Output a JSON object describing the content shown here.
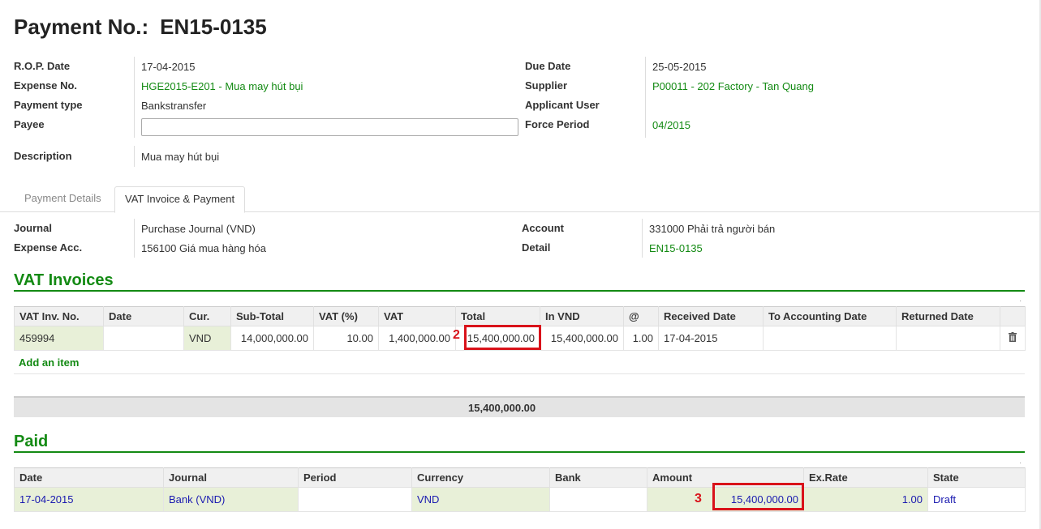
{
  "header": {
    "title_label": "Payment No.:",
    "title_value": "EN15-0135"
  },
  "form": {
    "rop_date_label": "R.O.P. Date",
    "rop_date": "17-04-2015",
    "expense_no_label": "Expense No.",
    "expense_no": "HGE2015-E201 - Mua may hút bụi",
    "payment_type_label": "Payment type",
    "payment_type": "Bankstransfer",
    "payee_label": "Payee",
    "payee_value": "",
    "description_label": "Description",
    "description": "Mua may hút bụi",
    "due_date_label": "Due Date",
    "due_date": "25-05-2015",
    "supplier_label": "Supplier",
    "supplier": "P00011 - 202 Factory - Tan Quang",
    "applicant_label": "Applicant User",
    "applicant": "",
    "force_period_label": "Force Period",
    "force_period": "04/2015"
  },
  "tabs": [
    "Payment Details",
    "VAT Invoice & Payment"
  ],
  "active_tab": 1,
  "vat_tab": {
    "journal_label": "Journal",
    "journal": "Purchase Journal (VND)",
    "expense_acc_label": "Expense Acc.",
    "expense_acc": "156100 Giá mua hàng hóa",
    "account_label": "Account",
    "account": "331000 Phải trả người bán",
    "detail_label": "Detail",
    "detail": "EN15-0135"
  },
  "vat_invoices": {
    "title": "VAT Invoices",
    "columns": [
      "VAT Inv. No.",
      "Date",
      "Cur.",
      "Sub-Total",
      "VAT (%)",
      "VAT",
      "Total",
      "In VND",
      "@",
      "Received Date",
      "To Accounting Date",
      "Returned Date"
    ],
    "rows": [
      {
        "inv_no": "459994",
        "date": "",
        "cur": "VND",
        "sub_total": "14,000,000.00",
        "vat_pct": "10.00",
        "vat": "1,400,000.00",
        "total": "15,400,000.00",
        "in_vnd": "15,400,000.00",
        "rate": "1.00",
        "received_date": "17-04-2015",
        "to_accounting_date": "",
        "returned_date": ""
      }
    ],
    "add_item": "Add an item",
    "footer_total": "15,400,000.00"
  },
  "paid": {
    "title": "Paid",
    "columns": [
      "Date",
      "Journal",
      "Period",
      "Currency",
      "Bank",
      "Amount",
      "Ex.Rate",
      "State"
    ],
    "rows": [
      {
        "date": "17-04-2015",
        "journal": "Bank (VND)",
        "period": "",
        "currency": "VND",
        "bank": "",
        "amount": "15,400,000.00",
        "ex_rate": "1.00",
        "state": "Draft"
      }
    ]
  },
  "annotations": {
    "marker_total": "2",
    "marker_amount": "3",
    "color": "#d9121a"
  },
  "icons": {
    "delete": "trash-icon"
  },
  "colors": {
    "link_green": "#138a13",
    "link_blue": "#1a1ab0",
    "required_bg": "#e8f0d8"
  }
}
